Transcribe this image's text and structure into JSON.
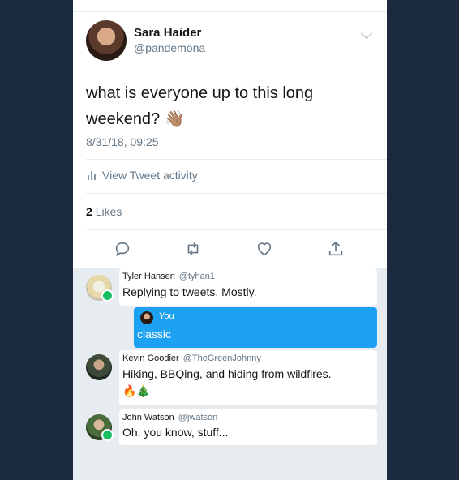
{
  "tweet": {
    "author_name": "Sara Haider",
    "author_handle": "@pandemona",
    "text": "what is everyone up to this long weekend?",
    "emoji": "👋🏽",
    "timestamp": "8/31/18, 09:25",
    "activity_label": "View Tweet activity",
    "likes_count": "2",
    "likes_label": "Likes"
  },
  "actions": [
    {
      "icon": "reply-icon"
    },
    {
      "icon": "retweet-icon"
    },
    {
      "icon": "like-icon"
    },
    {
      "icon": "share-icon"
    }
  ],
  "thread": [
    {
      "name": "Tyler Hansen",
      "handle": "@tyhan1",
      "text": "Replying to tweets. Mostly.",
      "online": true
    },
    {
      "name": "You",
      "text": "classic",
      "self": true
    },
    {
      "name": "Kevin Goodier",
      "handle": "@TheGreenJohnny",
      "text": "Hiking, BBQing, and hiding from wildfires.",
      "emoji": "🔥🎄",
      "online": false
    },
    {
      "name": "John Watson",
      "handle": "@jwatson",
      "text": "Oh, you know, stuff...",
      "online": true
    }
  ],
  "colors": {
    "background": "#1b2a3f",
    "accent": "#1da1f2",
    "online": "#17bf63"
  }
}
